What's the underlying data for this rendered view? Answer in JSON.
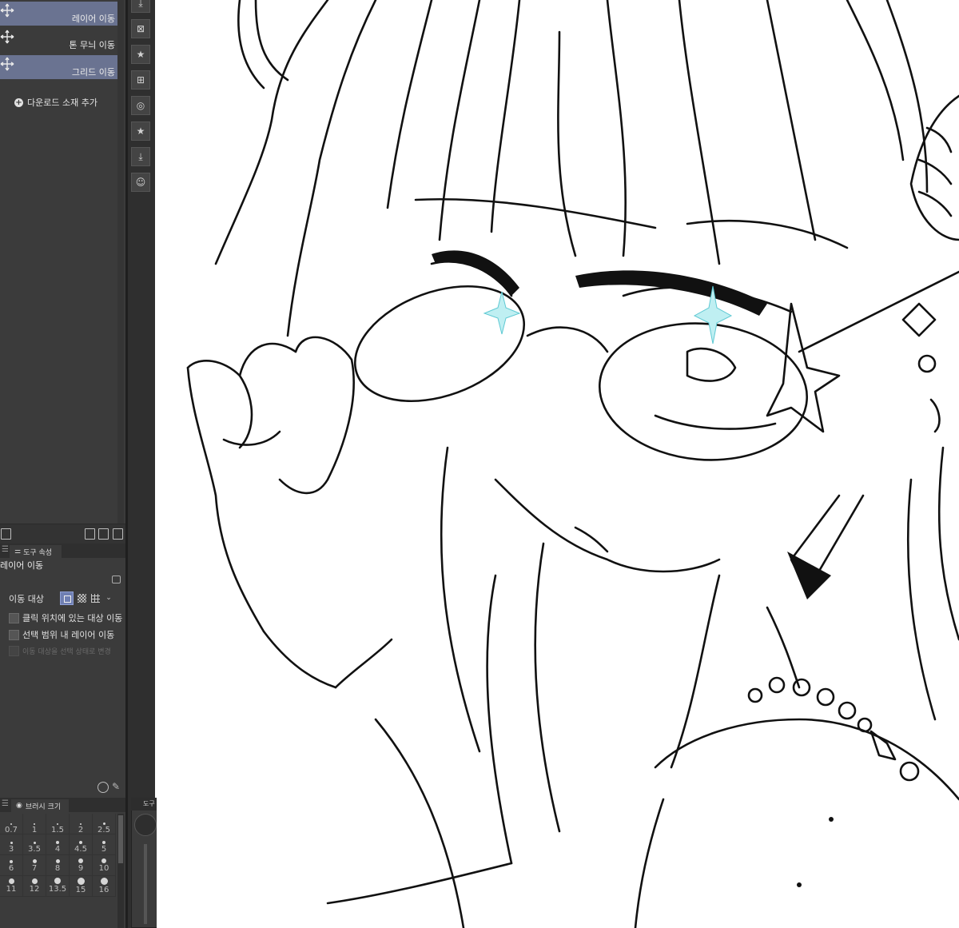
{
  "subtool": {
    "items": [
      {
        "label": "레이어 이동",
        "selected": true,
        "icon": "move-arrows-icon"
      },
      {
        "label": "톤 무늬 이동",
        "selected": false,
        "icon": "move-arrows-icon"
      },
      {
        "label": "그리드 이동",
        "selected": true,
        "icon": "move-arrows-icon"
      }
    ],
    "add_material": "다운로드 소재 추가"
  },
  "tool_property": {
    "tab_label": "도구 속성",
    "title": "레이어 이동",
    "move_target_label": "이동 대상",
    "options": [
      {
        "label": "클릭 위치에 있는 대상 이동",
        "checked": false,
        "enabled": true
      },
      {
        "label": "선택 범위 내 레이어 이동",
        "checked": false,
        "enabled": true
      },
      {
        "label": "이동 대상을 선택 상태로 변경",
        "checked": false,
        "enabled": false
      }
    ]
  },
  "brush_size": {
    "tab_label": "브러시 크기",
    "rows": [
      [
        "0.7",
        "1",
        "1.5",
        "2",
        "2.5"
      ],
      [
        "3",
        "3.5",
        "4",
        "4.5",
        "5"
      ],
      [
        "6",
        "7",
        "8",
        "9",
        "10"
      ],
      [
        "11",
        "12",
        "13.5",
        "15",
        "16"
      ]
    ]
  },
  "color_panel": {
    "title": "도구",
    "main_color": "#2e2e2e",
    "sub_color": "#6a6e9a"
  },
  "accent": "#6a7391"
}
